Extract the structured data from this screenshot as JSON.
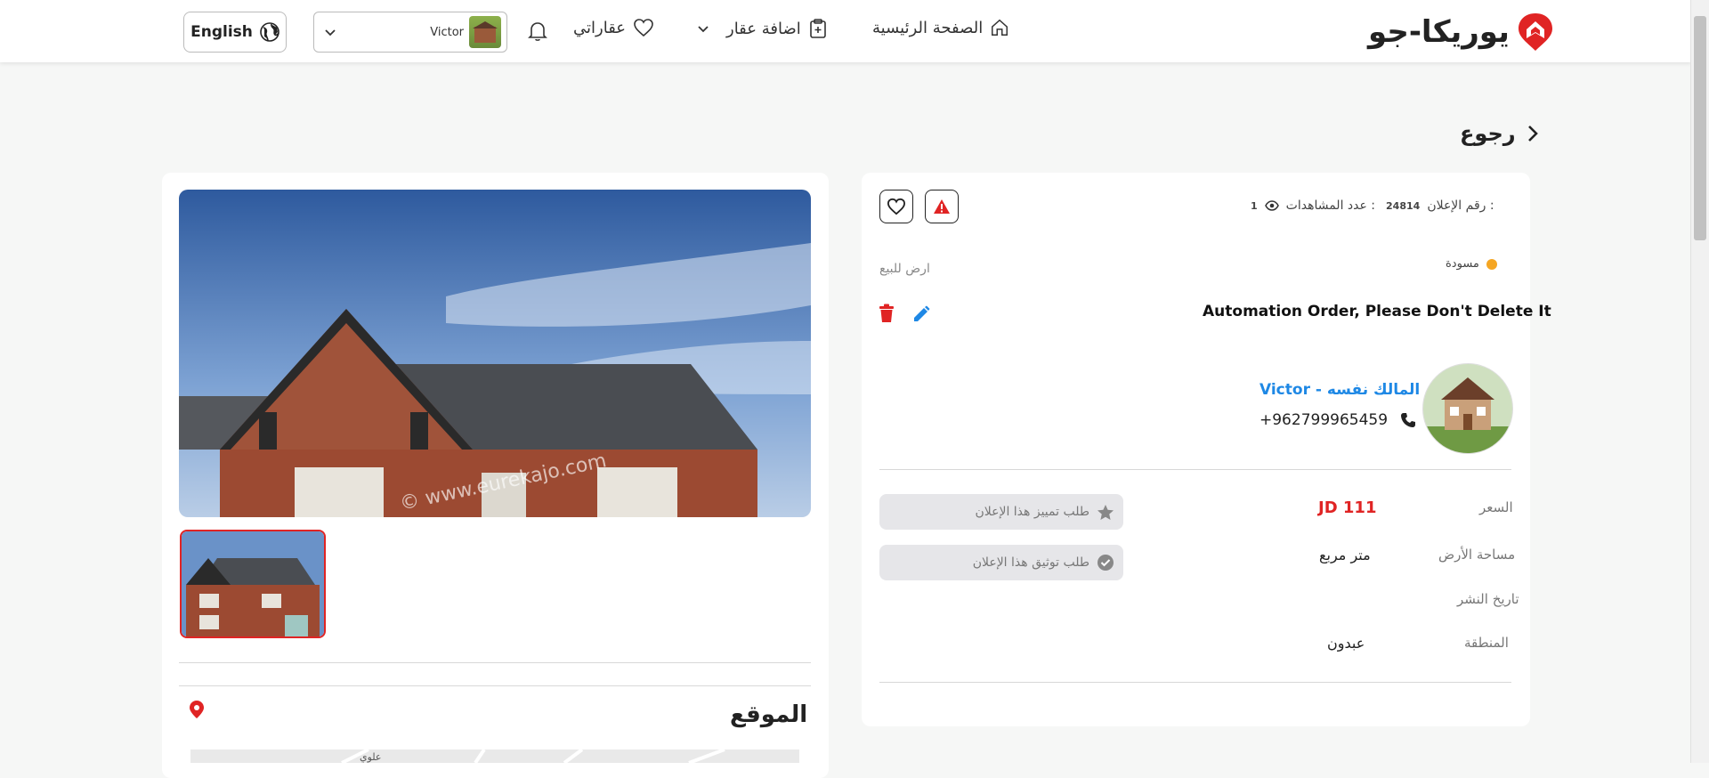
{
  "header": {
    "logo_text": "يوريكا-جو",
    "nav": {
      "home": "الصفحة الرئيسية",
      "add_property": "اضافة عقار",
      "my_properties": "عقاراتي"
    },
    "user_name": "Victor",
    "language_button": "English"
  },
  "back_label": "رجوع",
  "listing": {
    "ad_number_label": "رقم الإعلان :",
    "ad_number": "24814",
    "views_label": "عدد المشاهدات :",
    "views_count": "1",
    "status": "مسودة",
    "category": "ارض للبيع",
    "title": "Automation Order, Please Don't Delete It",
    "owner_link": "Victor - المالك نفسه",
    "phone": "+962799965459",
    "price_label": "السعر",
    "price_value": "JD 111",
    "area_label": "مساحة الأرض",
    "area_value": "متر مربع",
    "publish_date_label": "تاريخ النشر",
    "region_label": "المنطقة",
    "region_value": "عبدون",
    "feature_request": "طلب تمييز هذا الإعلان",
    "verify_request": "طلب توثيق هذا الإعلان"
  },
  "gallery": {
    "watermark": "© www.eurekajo.com"
  },
  "location": {
    "title": "الموقع",
    "map_labels": [
      "علوي"
    ]
  },
  "colors": {
    "accent_red": "#e02424",
    "link_blue": "#1e88e5",
    "status_orange": "#f5a623"
  },
  "icons": {
    "home": "home-icon",
    "add": "clipboard-plus-icon",
    "heart": "heart-icon",
    "bell": "bell-icon",
    "globe": "globe-icon",
    "eye": "eye-icon",
    "phone": "phone-icon",
    "star": "star-icon",
    "check": "check-circle-icon",
    "edit": "pencil-icon",
    "delete": "trash-icon",
    "report": "warning-icon",
    "pin": "map-pin-icon"
  }
}
